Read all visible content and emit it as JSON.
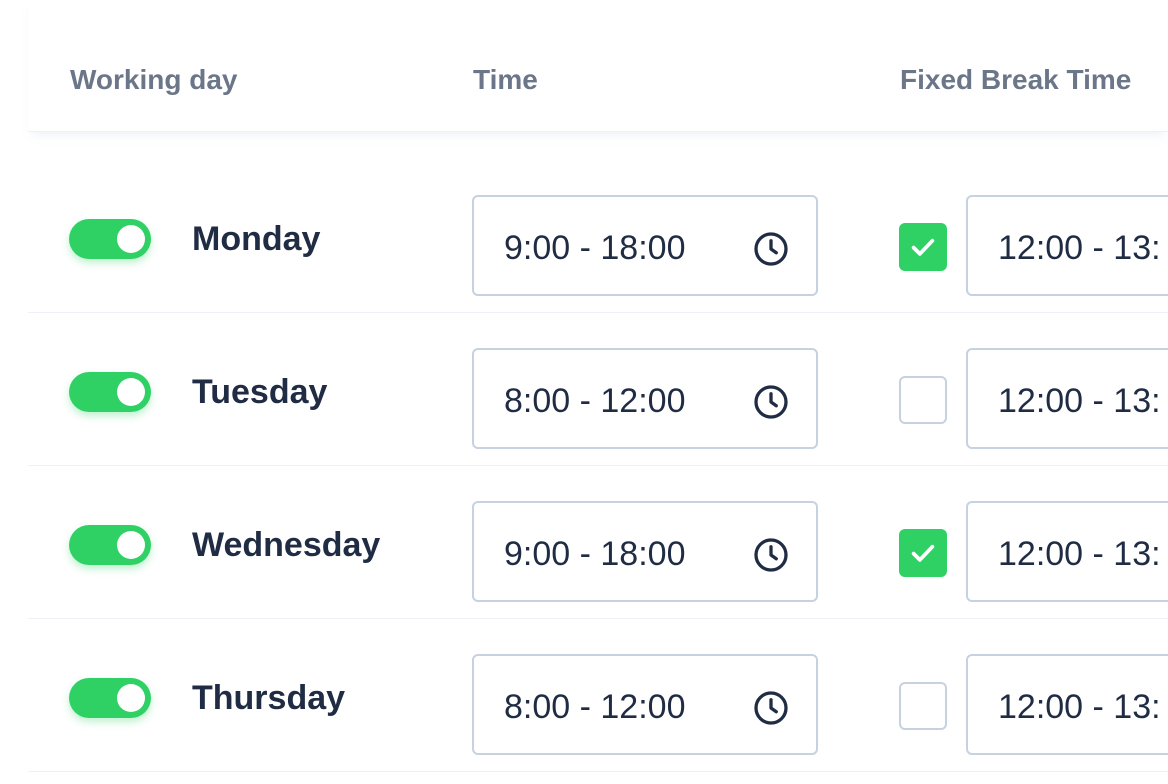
{
  "header": {
    "working_day": "Working day",
    "time": "Time",
    "fixed_break_time": "Fixed Break Time"
  },
  "rows": [
    {
      "day": "Monday",
      "enabled": true,
      "time": "9:00 - 18:00",
      "fixed_break": true,
      "break_time": "12:00 - 13:"
    },
    {
      "day": "Tuesday",
      "enabled": true,
      "time": "8:00 - 12:00",
      "fixed_break": false,
      "break_time": "12:00 - 13:"
    },
    {
      "day": "Wednesday",
      "enabled": true,
      "time": "9:00 - 18:00",
      "fixed_break": true,
      "break_time": "12:00 - 13:"
    },
    {
      "day": "Thursday",
      "enabled": true,
      "time": "8:00 - 12:00",
      "fixed_break": false,
      "break_time": "12:00 - 13:"
    }
  ],
  "icons": {
    "time": "clock-icon",
    "check": "checkmark-icon"
  },
  "colors": {
    "accent": "#2fd165",
    "text": "#1f2c44",
    "header_text": "#6b7689",
    "border": "#c6d2e0"
  }
}
